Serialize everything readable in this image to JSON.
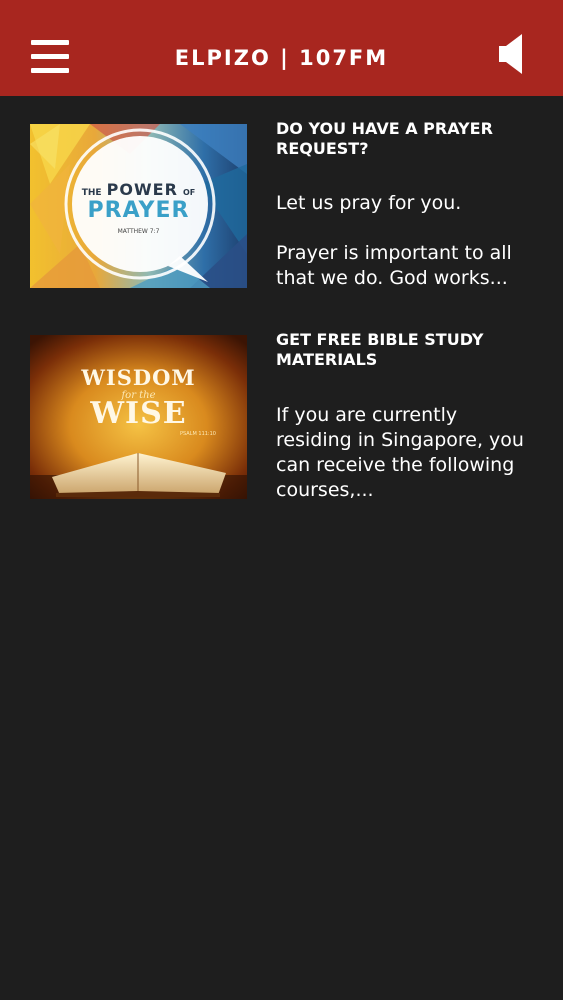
{
  "header": {
    "title": "ELPIZO | 107FM",
    "menu_icon": "hamburger-menu-icon",
    "volume_icon": "speaker-icon",
    "color": "#a8261f"
  },
  "articles": [
    {
      "title": "DO YOU HAVE A PRAYER REQUEST?",
      "excerpt": "Let us pray for you.\n\nPrayer is important to all that we do. God works...",
      "image": {
        "line1_small": "THE",
        "line1_big": "POWER",
        "line1_of": "OF",
        "line2": "PRAYER",
        "ref": "MATTHEW 7:7"
      }
    },
    {
      "title": "GET FREE BIBLE STUDY MATERIALS",
      "excerpt": "If you are currently residing in Singapore, you can receive the following courses,...",
      "image": {
        "line1": "WISDOM",
        "line2": "for the",
        "line3": "WISE",
        "ref": "PSALM 111:10"
      }
    }
  ]
}
